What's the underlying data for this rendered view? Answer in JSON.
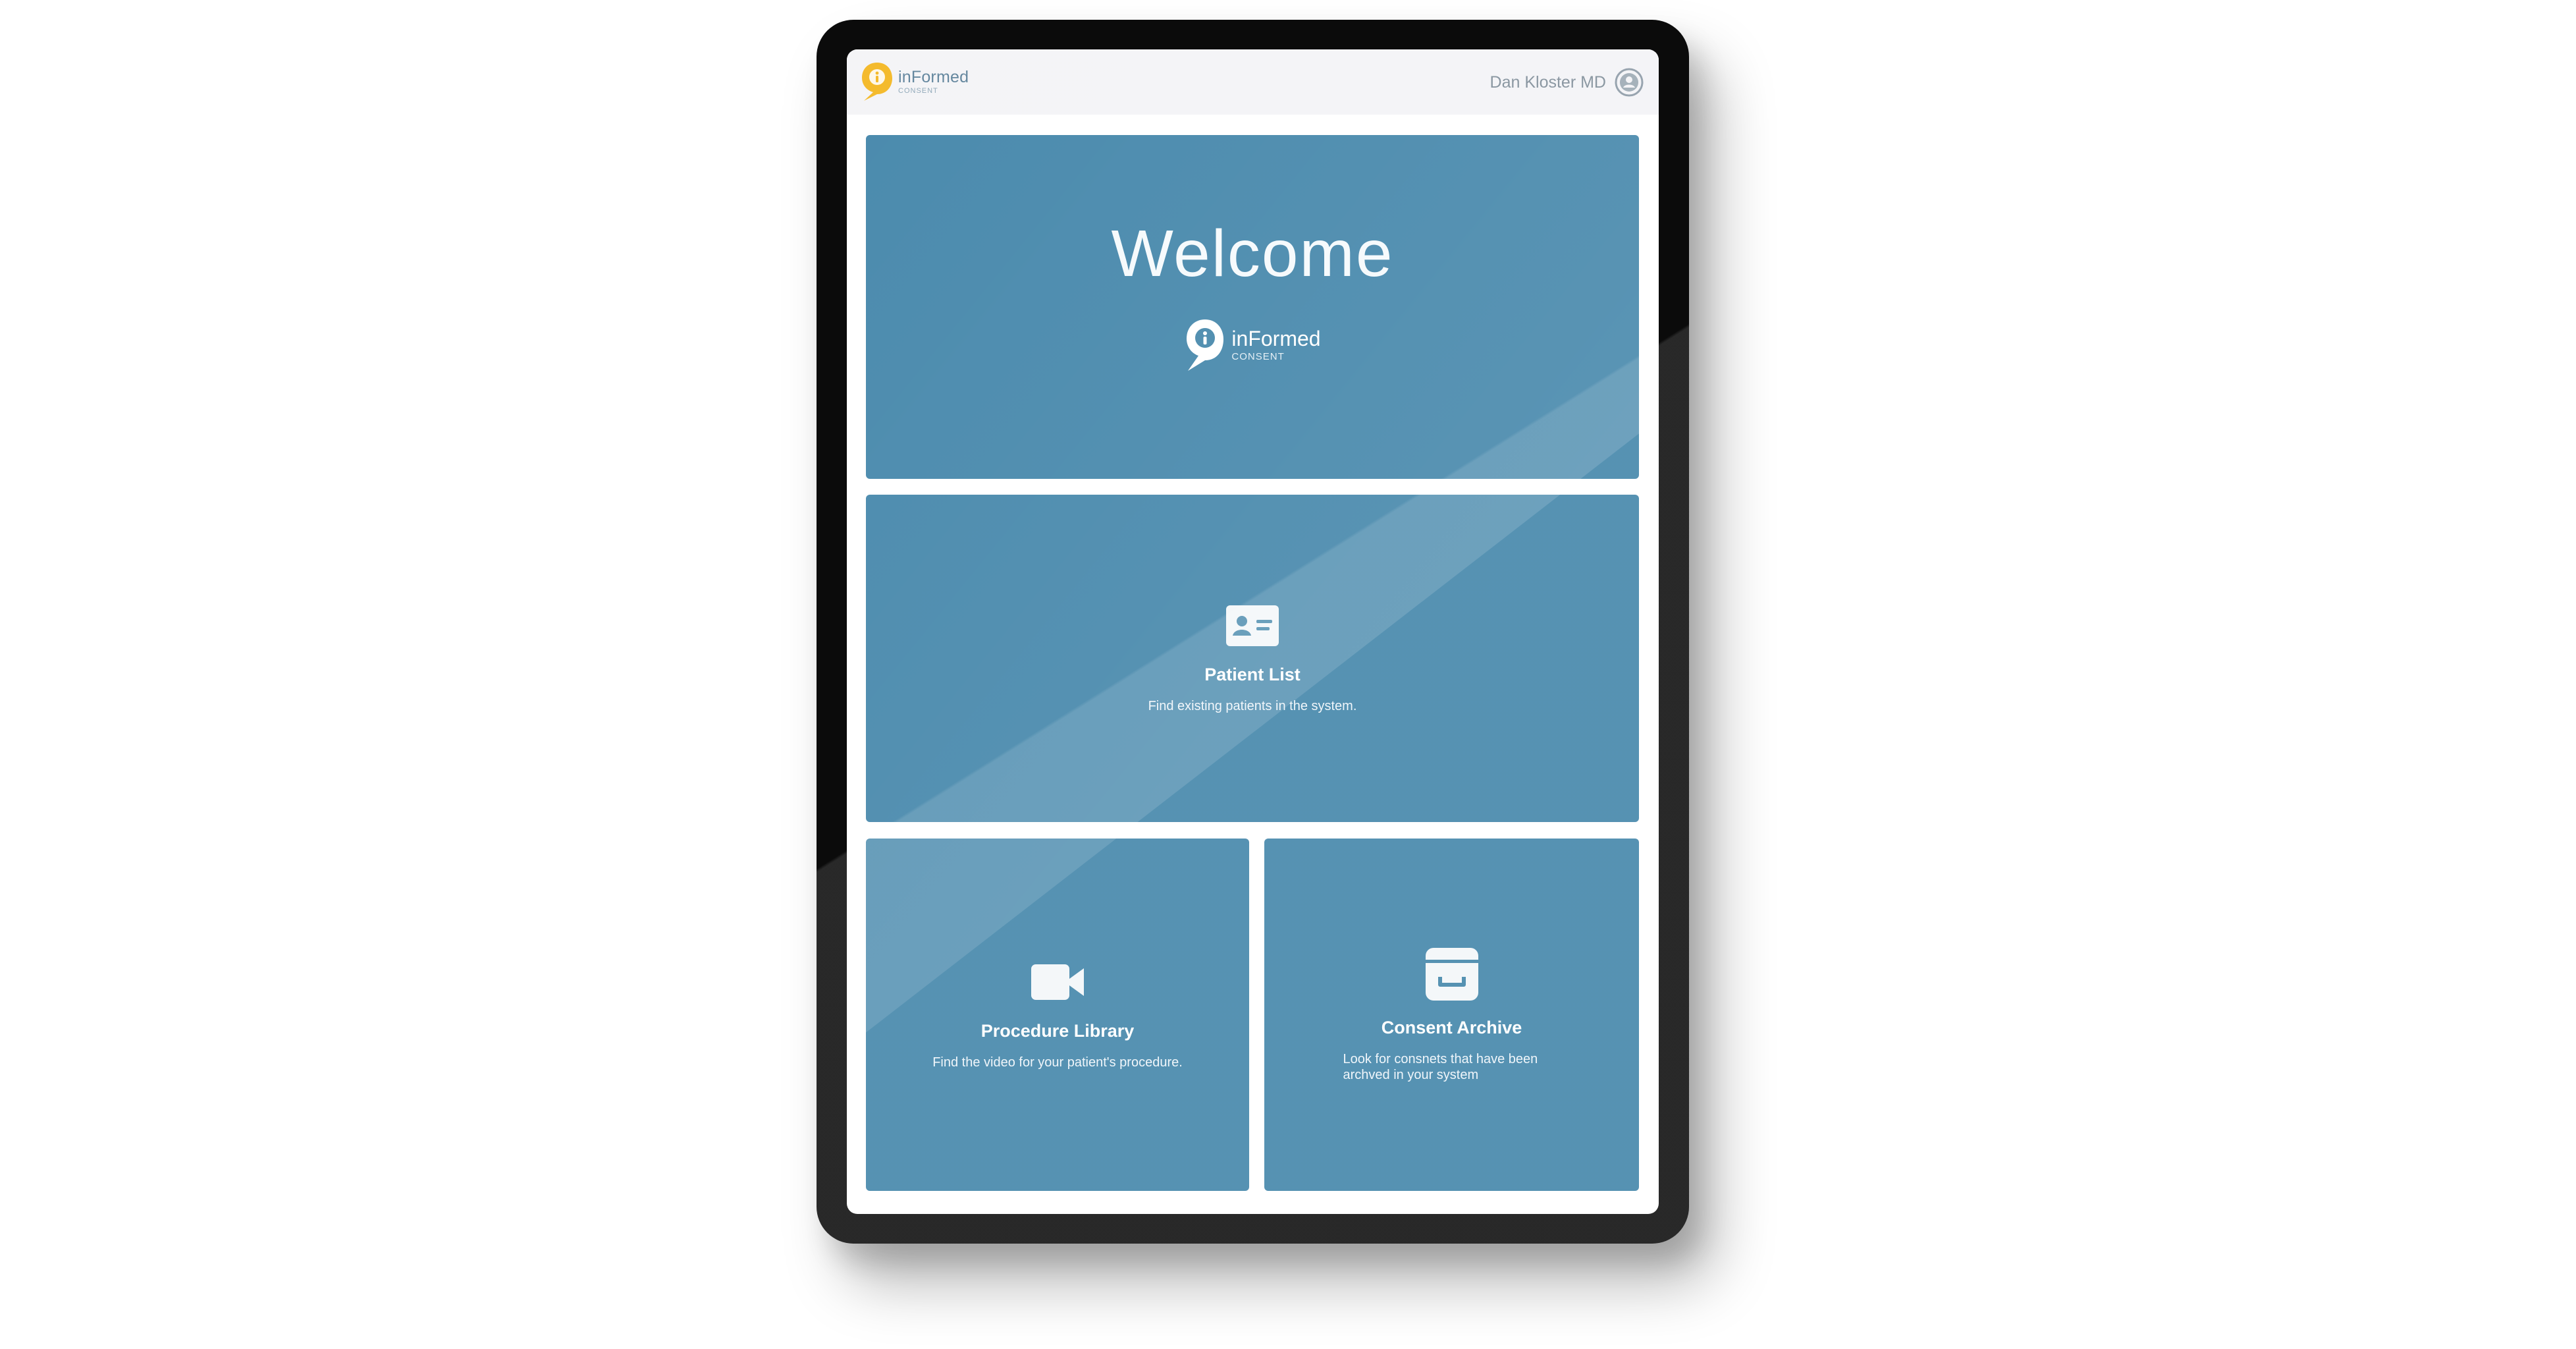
{
  "app": {
    "brand_name": "inFormed",
    "brand_sub": "CONSENT"
  },
  "header": {
    "user_name": "Dan Kloster MD"
  },
  "welcome": {
    "title": "Welcome",
    "logo_name": "inFormed",
    "logo_sub": "CONSENT"
  },
  "tiles": {
    "patient_list": {
      "title": "Patient List",
      "description": "Find existing patients in the system.",
      "icon": "id-card-icon"
    },
    "procedure_library": {
      "title": "Procedure Library",
      "description": "Find the video for your patient's procedure.",
      "icon": "video-camera-icon"
    },
    "consent_archive": {
      "title": "Consent Archive",
      "description": "Look for consnets that have been archved in your system",
      "icon": "archive-box-icon"
    }
  },
  "colors": {
    "tile_blue": "#3f83a8",
    "brand_yellow": "#f3b61f",
    "topbar_bg": "#f3f3f6",
    "device_black": "#0b0b0b"
  }
}
